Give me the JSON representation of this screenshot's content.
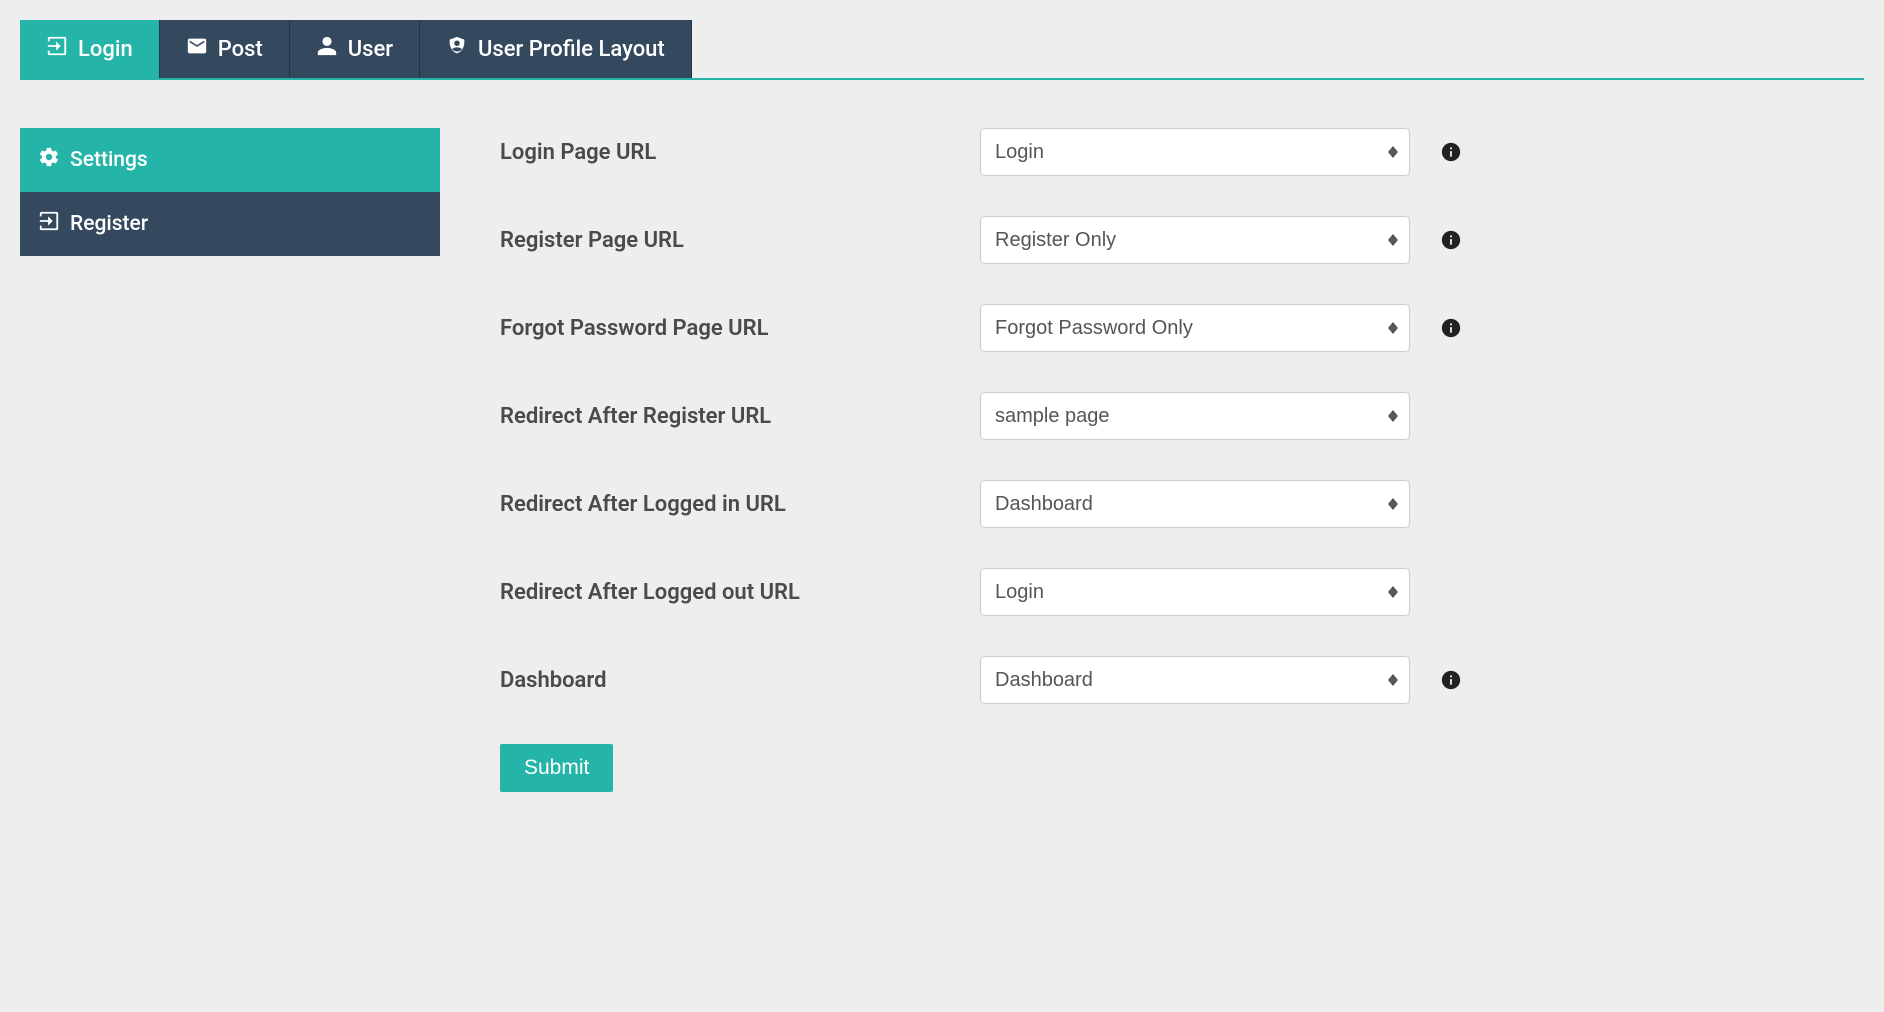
{
  "topTabs": [
    {
      "label": "Login"
    },
    {
      "label": "Post"
    },
    {
      "label": "User"
    },
    {
      "label": "User Profile Layout"
    }
  ],
  "sideNav": [
    {
      "label": "Settings"
    },
    {
      "label": "Register"
    }
  ],
  "form": {
    "fields": [
      {
        "label": "Login Page URL",
        "value": "Login",
        "hasInfo": true
      },
      {
        "label": "Register Page URL",
        "value": "Register Only",
        "hasInfo": true
      },
      {
        "label": "Forgot Password Page URL",
        "value": "Forgot Password Only",
        "hasInfo": true
      },
      {
        "label": "Redirect After Register URL",
        "value": "sample page",
        "hasInfo": false
      },
      {
        "label": "Redirect After Logged in URL",
        "value": "Dashboard",
        "hasInfo": false
      },
      {
        "label": "Redirect After Logged out URL",
        "value": "Login",
        "hasInfo": false
      },
      {
        "label": "Dashboard",
        "value": "Dashboard",
        "hasInfo": true
      }
    ],
    "submitLabel": "Submit"
  }
}
